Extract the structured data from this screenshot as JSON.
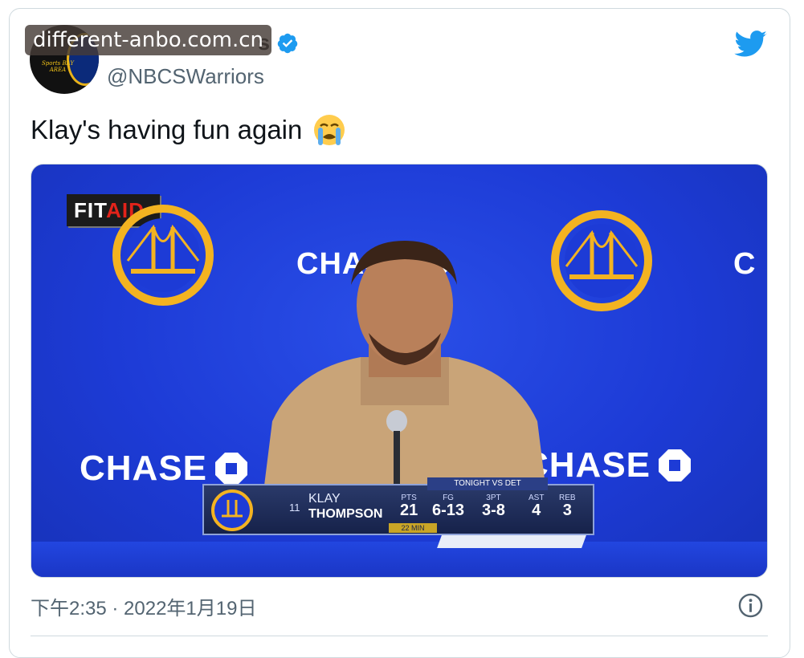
{
  "tweet": {
    "display_name": "NBC Sports Warriors",
    "display_name_visible": "s",
    "handle": "@NBCSWarriors",
    "text": "Klay's having fun again",
    "emoji": "loudly-crying-face",
    "timestamp": "下午2:35 · 2022年1月19日",
    "avatar_text": "Sports BAY AREA"
  },
  "watermark": {
    "text": "different-anbo.com.cn"
  },
  "video": {
    "overlay_brand_fit": "FIT",
    "overlay_brand_aid": "AID",
    "sponsor": "CHASE",
    "team_logo_top": "GOLDEN STATE",
    "team_logo_bottom": "WARRIORS",
    "scorebug": {
      "number": "11",
      "first_name": "KLAY",
      "last_name": "THOMPSON",
      "header": "TONIGHT VS DET",
      "minutes": "22 MIN",
      "stats": [
        {
          "label": "PTS",
          "value": "21"
        },
        {
          "label": "FG",
          "value": "6-13"
        },
        {
          "label": "3PT",
          "value": "3-8"
        },
        {
          "label": "AST",
          "value": "4"
        },
        {
          "label": "REB",
          "value": "3"
        }
      ]
    }
  },
  "colors": {
    "twitter_blue": "#1d9bf0",
    "backdrop_blue": "#1d3bd6",
    "warriors_gold": "#f3b321",
    "text_secondary": "#536471"
  },
  "icons": [
    "verified-badge-icon",
    "twitter-bird-icon",
    "info-icon"
  ]
}
